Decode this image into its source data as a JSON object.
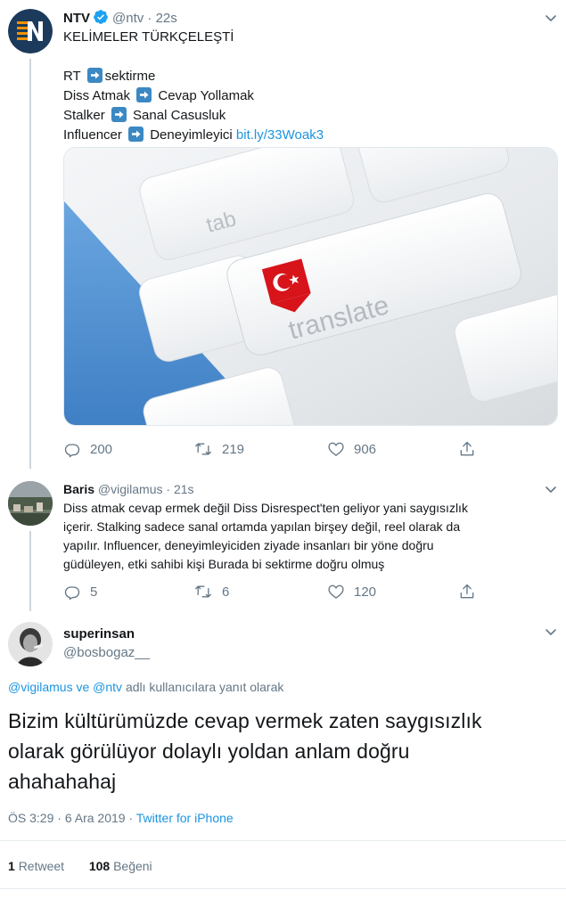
{
  "tweet1": {
    "name": "NTV",
    "handle": "@ntv",
    "sep": "·",
    "time": "22s",
    "lines": {
      "title": "KELİMELER TÜRKÇELEŞTİ",
      "l1a": "RT",
      "l1b": "sektirme",
      "l2a": "Diss Atmak",
      "l2b": "Cevap Yollamak",
      "l3a": "Stalker",
      "l3b": "Sanal Casusluk",
      "l4a": "Influencer",
      "l4b": "Deneyimleyici",
      "link": "bit.ly/33Woak3"
    },
    "photo": {
      "key_tab": "tab",
      "key_translate": "translate"
    },
    "actions": {
      "replies": "200",
      "retweets": "219",
      "likes": "906"
    }
  },
  "tweet2": {
    "name": "Baris",
    "handle": "@vigilamus",
    "sep": "·",
    "time": "21s",
    "lines": [
      "Diss atmak cevap ermek değil Diss Disrespect'ten geliyor yani saygısızlık",
      "içerir. Stalking sadece sanal ortamda yapılan birşey değil, reel olarak da",
      "yapılır. Influencer, deneyimleyiciden ziyade insanları bir yöne doğru",
      "güdüleyen, etki sahibi kişi Burada bi sektirme doğru olmuş"
    ],
    "actions": {
      "replies": "5",
      "retweets": "6",
      "likes": "120"
    }
  },
  "tweet3": {
    "name": "superinsan",
    "handle": "@bosbogaz__",
    "replying": {
      "user1": "@vigilamus",
      "and": "ve",
      "user2": "@ntv",
      "rest": "adlı kullanıcılara yanıt olarak"
    },
    "lines": [
      "Bizim kültürümüzde cevap vermek zaten saygısızlık",
      "olarak görülüyor dolaylı yoldan anlam doğru",
      "ahahahahaj"
    ],
    "time": "ÖS 3:29",
    "sep": "·",
    "date": "6 Ara 2019",
    "source": "Twitter for iPhone",
    "stats": {
      "retweets_count": "1",
      "retweets_label": "Retweet",
      "likes_count": "108",
      "likes_label": "Beğeni"
    }
  },
  "colors": {
    "link": "#1b95e0",
    "muted": "#657786",
    "verified": "#1da1f2",
    "ntv_orange": "#f29100"
  }
}
